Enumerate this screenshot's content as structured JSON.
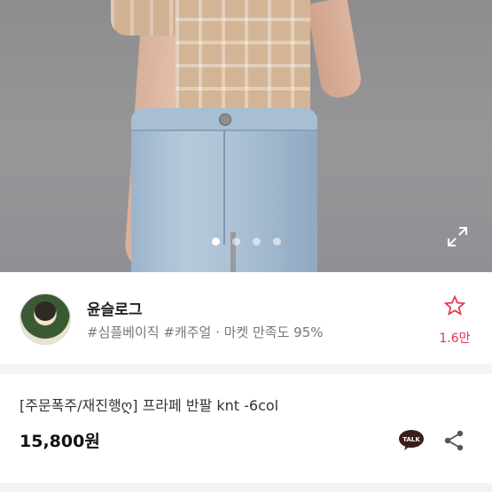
{
  "carousel": {
    "dot_count": 4,
    "active_index": 0
  },
  "seller": {
    "name": "윤슬로그",
    "tags": "#심플베이직 #캐주얼 · 마켓 만족도 95%",
    "like_count": "1.6만"
  },
  "product": {
    "title": "[주문폭주/재진행ღ] 프라페 반팔 knt -6col",
    "price": "15,800원"
  },
  "icons": {
    "expand": "expand-icon",
    "star": "star-icon",
    "talk": "talk-icon",
    "share": "share-icon"
  },
  "colors": {
    "accent": "#e8344e",
    "talk_bg": "#3a1d1d"
  },
  "talk_label": "TALK"
}
